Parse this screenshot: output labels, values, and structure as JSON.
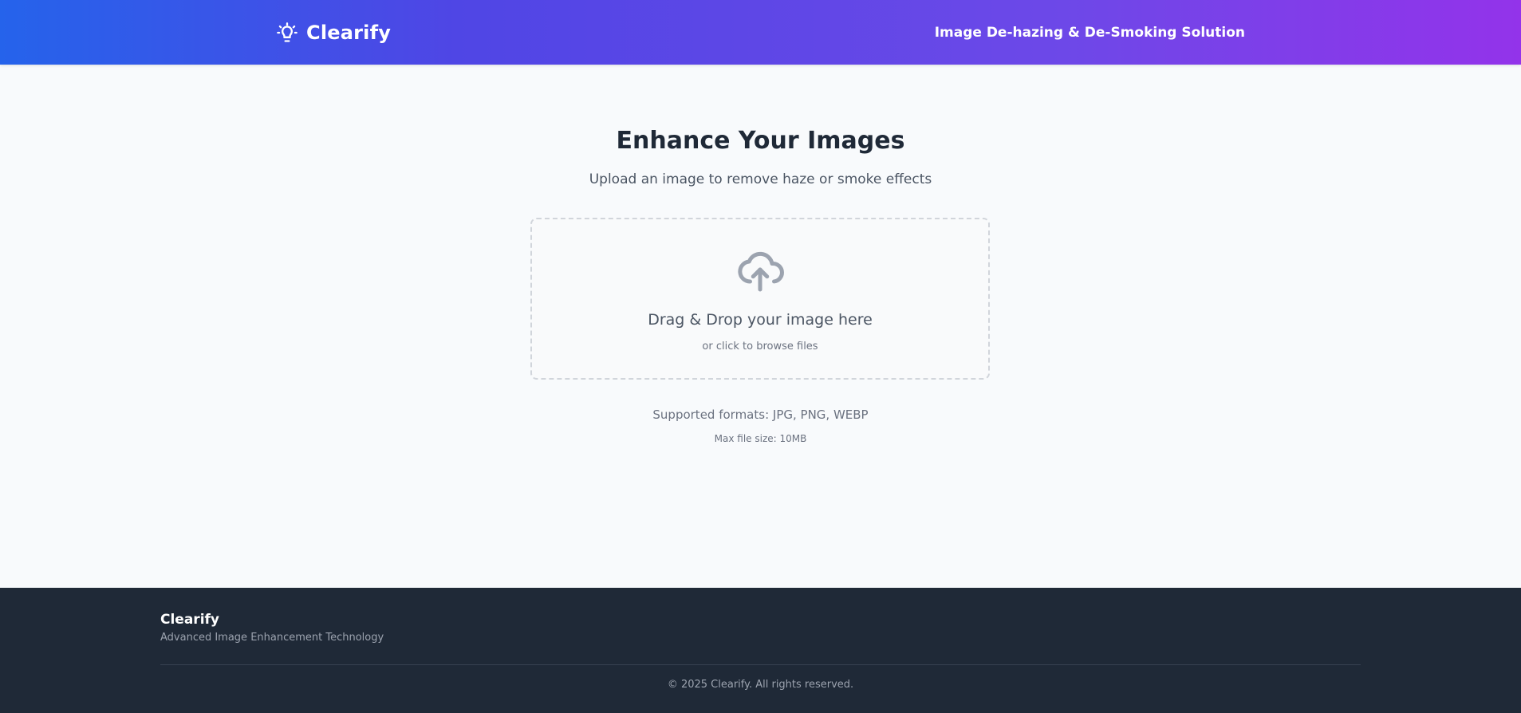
{
  "header": {
    "brand_name": "Clearify",
    "brand_icon": "lightbulb-icon",
    "tagline": "Image De-hazing & De-Smoking Solution"
  },
  "main": {
    "title": "Enhance Your Images",
    "subtitle": "Upload an image to remove haze or smoke effects",
    "dropzone": {
      "icon": "cloud-upload-icon",
      "title": "Drag & Drop your image here",
      "subtitle": "or click to browse files"
    },
    "formats": "Supported formats: JPG, PNG, WEBP",
    "max_size": "Max file size: 10MB"
  },
  "footer": {
    "brand_name": "Clearify",
    "tagline": "Advanced Image Enhancement Technology",
    "copyright": "© 2025 Clearify. All rights reserved."
  },
  "colors": {
    "header_gradient_start": "#2563eb",
    "header_gradient_end": "#9333ea",
    "page_background": "#f8fafc",
    "footer_background": "#1f2937",
    "title_text": "#1f2937",
    "muted_text": "#6b7280"
  }
}
